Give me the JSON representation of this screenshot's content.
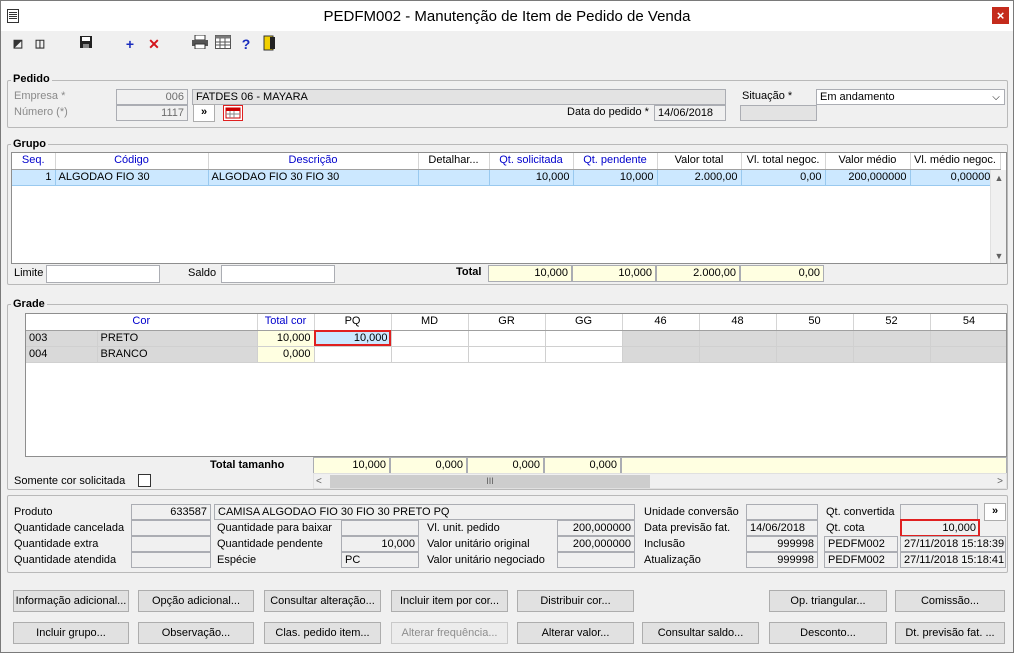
{
  "window": {
    "title": "PEDFM002 - Manutenção de Item de Pedido de Venda",
    "close": "×"
  },
  "pedido": {
    "section": "Pedido",
    "empresa_label": "Empresa *",
    "empresa_code": "006",
    "empresa_name": "FATDES 06 - MAYARA",
    "numero_label": "Número (*)",
    "numero": "1117",
    "nav_btn": "»",
    "data_label": "Data do pedido *",
    "data": "14/06/2018",
    "situacao_label": "Situação *",
    "situacao": "Em andamento"
  },
  "grupo": {
    "section": "Grupo",
    "headers": [
      "Seq.",
      "Código",
      "Descrição",
      "Detalhar...",
      "Qt. solicitada",
      "Qt. pendente",
      "Valor total",
      "Vl. total negoc.",
      "Valor médio",
      "Vl. médio negoc."
    ],
    "rows": [
      [
        "1",
        "ALGODAO FIO 30",
        "ALGODAO FIO 30 FIO 30",
        "",
        "10,000",
        "10,000",
        "2.000,00",
        "0,00",
        "200,000000",
        "0,000000"
      ]
    ],
    "limite_label": "Limite",
    "saldo_label": "Saldo",
    "total_label": "Total",
    "totals": [
      "10,000",
      "10,000",
      "2.000,00",
      "0,00"
    ]
  },
  "grade": {
    "section": "Grade",
    "headers": [
      "Cor",
      "Total cor",
      "PQ",
      "MD",
      "GR",
      "GG",
      "46",
      "48",
      "50",
      "52",
      "54"
    ],
    "rows": [
      {
        "code": "003",
        "name": "PRETO",
        "total": "10,000",
        "sizes": [
          "10,000",
          "",
          "",
          ""
        ]
      },
      {
        "code": "004",
        "name": "BRANCO",
        "total": "0,000",
        "sizes": [
          "",
          "",
          "",
          ""
        ]
      }
    ],
    "total_label": "Total tamanho",
    "totals": [
      "10,000",
      "0,000",
      "0,000",
      "0,000"
    ],
    "somente_label": "Somente cor solicitada",
    "scroll_left": "<",
    "scroll_thumb": "III",
    "scroll_right": ">"
  },
  "produto": {
    "produto_label": "Produto",
    "produto_code": "633587",
    "produto_desc": "CAMISA ALGODAO FIO 30 FIO 30 PRETO PQ",
    "qt_cancelada_label": "Quantidade cancelada",
    "qt_extra_label": "Quantidade extra",
    "qt_atendida_label": "Quantidade atendida",
    "qt_baixar_label": "Quantidade para baixar",
    "qt_pendente_label": "Quantidade pendente",
    "qt_pendente": "10,000",
    "especie_label": "Espécie",
    "especie": "PC",
    "vl_unit_pedido_label": "Vl. unit. pedido",
    "vl_unit_pedido": "200,000000",
    "vl_unit_original_label": "Valor unitário original",
    "vl_unit_original": "200,000000",
    "vl_unit_negociado_label": "Valor unitário negociado",
    "unidade_conversao_label": "Unidade conversão",
    "data_prev_label": "Data previsão fat.",
    "data_prev": "14/06/2018",
    "inclusao_label": "Inclusão",
    "inclusao_user": "999998",
    "inclusao_prog": "PEDFM002",
    "inclusao_dt": "27/11/2018 15:18:39",
    "atualizacao_label": "Atualização",
    "atualizacao_user": "999998",
    "atualizacao_prog": "PEDFM002",
    "atualizacao_dt": "27/11/2018 15:18:41",
    "qt_convertida_label": "Qt. convertida",
    "qt_cota_label": "Qt. cota",
    "qt_cota": "10,000",
    "more_btn": "»"
  },
  "buttons": {
    "info_adicional": "Informação adicional...",
    "opcao_adicional": "Opção adicional...",
    "consultar_alteracao": "Consultar alteração...",
    "incluir_item_cor": "Incluir item por cor...",
    "distribuir_cor": "Distribuir cor...",
    "op_triangular": "Op. triangular...",
    "comissao": "Comissão...",
    "incluir_grupo": "Incluir grupo...",
    "observacao": "Observação...",
    "clas_pedido_item": "Clas. pedido item...",
    "alterar_frequencia": "Alterar frequência...",
    "alterar_valor": "Alterar valor...",
    "consultar_saldo": "Consultar saldo...",
    "desconto": "Desconto...",
    "dt_previsao_fat": "Dt. previsão fat. ..."
  }
}
